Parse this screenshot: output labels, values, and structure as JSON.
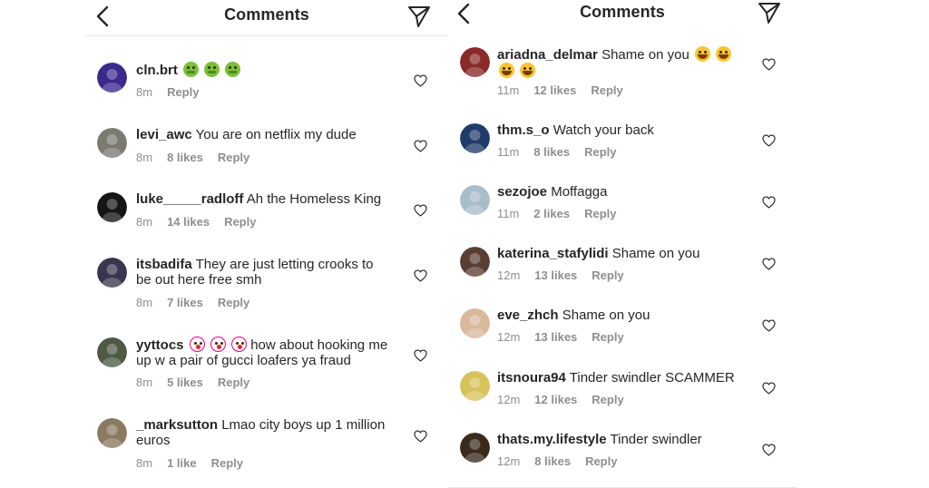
{
  "left": {
    "title": "Comments",
    "comments": [
      {
        "user": "cln.brt",
        "text": "",
        "time": "8m",
        "likes": "",
        "reply": "Reply",
        "emoji": [
          "sick",
          "sick",
          "sick"
        ],
        "avatar_color": "#3b2a8c"
      },
      {
        "user": "levi_awc",
        "text": "You are on netflix my dude",
        "time": "8m",
        "likes": "8 likes",
        "reply": "Reply",
        "avatar_color": "#7a7a72"
      },
      {
        "user": "luke_____radloff",
        "text": "Ah the Homeless King",
        "time": "8m",
        "likes": "14 likes",
        "reply": "Reply",
        "avatar_color": "#151515"
      },
      {
        "user": "itsbadifa",
        "text": "They are just letting crooks to be out here free smh",
        "time": "8m",
        "likes": "7 likes",
        "reply": "Reply",
        "avatar_color": "#3a3650"
      },
      {
        "user": "yyttocs",
        "text": "how about hooking me up w a pair of gucci loafers ya fraud",
        "time": "8m",
        "likes": "5 likes",
        "reply": "Reply",
        "emoji": [
          "clown",
          "clown",
          "clown"
        ],
        "avatar_color": "#4e5a44"
      },
      {
        "user": "_marksutton",
        "text": "Lmao city boys up 1 million euros",
        "time": "8m",
        "likes": "1 like",
        "reply": "Reply",
        "avatar_color": "#8a7a60"
      }
    ]
  },
  "right": {
    "title": "Comments",
    "comments": [
      {
        "user": "ariadna_delmar",
        "text": "Shame on you",
        "time": "11m",
        "likes": "12 likes",
        "reply": "Reply",
        "emoji": [
          "laugh",
          "laugh",
          "laugh",
          "laugh"
        ],
        "avatar_color": "#8a2a2a"
      },
      {
        "user": "thm.s_o",
        "text": "Watch your back",
        "time": "11m",
        "likes": "8 likes",
        "reply": "Reply",
        "avatar_color": "#1f3c6a"
      },
      {
        "user": "sezojoe",
        "text": "Moffagga",
        "time": "11m",
        "likes": "2 likes",
        "reply": "Reply",
        "avatar_color": "#a9bcc9"
      },
      {
        "user": "katerina_stafylidi",
        "text": "Shame on you",
        "time": "12m",
        "likes": "13 likes",
        "reply": "Reply",
        "avatar_color": "#5a3e34"
      },
      {
        "user": "eve_zhch",
        "text": "Shame on you",
        "time": "12m",
        "likes": "13 likes",
        "reply": "Reply",
        "avatar_color": "#d9b89c"
      },
      {
        "user": "itsnoura94",
        "text": "Tinder swindler SCAMMER",
        "time": "12m",
        "likes": "12 likes",
        "reply": "Reply",
        "avatar_color": "#d8c25a"
      },
      {
        "user": "thats.my.lifestyle",
        "text": "Tinder swindler",
        "time": "12m",
        "likes": "8 likes",
        "reply": "Reply",
        "avatar_color": "#3a2a1a"
      }
    ]
  },
  "icons": {
    "back": "chevron-left-icon",
    "send": "paper-plane-icon",
    "heart": "heart-outline-icon"
  },
  "colors": {
    "text": "#262626",
    "meta": "#8e8e8e",
    "divider": "#e6e6e6"
  }
}
